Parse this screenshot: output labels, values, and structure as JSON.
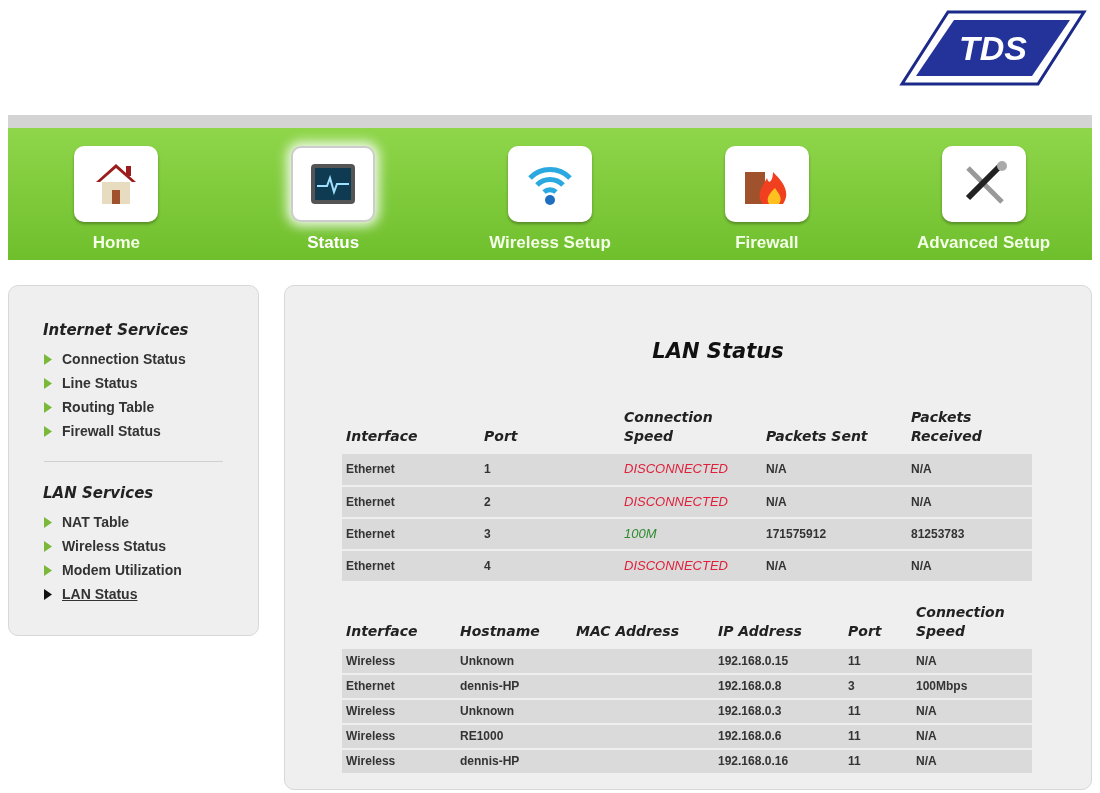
{
  "logo": {
    "text": "TDS"
  },
  "nav": [
    {
      "label": "Home",
      "kind": "home",
      "selected": false
    },
    {
      "label": "Status",
      "kind": "status",
      "selected": true
    },
    {
      "label": "Wireless Setup",
      "kind": "wireless",
      "selected": false
    },
    {
      "label": "Firewall",
      "kind": "firewall",
      "selected": false
    },
    {
      "label": "Advanced Setup",
      "kind": "tools",
      "selected": false
    }
  ],
  "sidebar": {
    "sections": [
      {
        "title": "Internet Services",
        "items": [
          {
            "label": "Connection Status",
            "selected": false
          },
          {
            "label": "Line Status",
            "selected": false
          },
          {
            "label": "Routing Table",
            "selected": false
          },
          {
            "label": "Firewall Status",
            "selected": false
          }
        ]
      },
      {
        "title": "LAN Services",
        "items": [
          {
            "label": "NAT Table",
            "selected": false
          },
          {
            "label": "Wireless Status",
            "selected": false
          },
          {
            "label": "Modem Utilization",
            "selected": false
          },
          {
            "label": "LAN Status",
            "selected": true
          }
        ]
      }
    ]
  },
  "title": "LAN Status",
  "ports_table": {
    "columns": [
      "Interface",
      "Port",
      "Connection Speed",
      "Packets Sent",
      "Packets Received"
    ],
    "rows": [
      {
        "interface": "Ethernet",
        "port": "1",
        "speed": {
          "text": "DISCONNECTED",
          "kind": "down"
        },
        "sent": "N/A",
        "received": "N/A"
      },
      {
        "interface": "Ethernet",
        "port": "2",
        "speed": {
          "text": "DISCONNECTED",
          "kind": "down"
        },
        "sent": "N/A",
        "received": "N/A"
      },
      {
        "interface": "Ethernet",
        "port": "3",
        "speed": {
          "text": "100M",
          "kind": "up"
        },
        "sent": "171575912",
        "received": "81253783"
      },
      {
        "interface": "Ethernet",
        "port": "4",
        "speed": {
          "text": "DISCONNECTED",
          "kind": "down"
        },
        "sent": "N/A",
        "received": "N/A"
      }
    ]
  },
  "hosts_table": {
    "columns": [
      "Interface",
      "Hostname",
      "MAC Address",
      "IP Address",
      "Port",
      "Connection Speed"
    ],
    "rows": [
      {
        "interface": "Wireless",
        "hostname": "Unknown",
        "ip": "192.168.0.15",
        "port": "11",
        "speed": "N/A"
      },
      {
        "interface": "Ethernet",
        "hostname": "dennis-HP",
        "ip": "192.168.0.8",
        "port": "3",
        "speed": "100Mbps"
      },
      {
        "interface": "Wireless",
        "hostname": "Unknown",
        "ip": "192.168.0.3",
        "port": "11",
        "speed": "N/A"
      },
      {
        "interface": "Wireless",
        "hostname": "RE1000",
        "ip": "192.168.0.6",
        "port": "11",
        "speed": "N/A"
      },
      {
        "interface": "Wireless",
        "hostname": "dennis-HP",
        "ip": "192.168.0.16",
        "port": "11",
        "speed": "N/A"
      }
    ]
  }
}
